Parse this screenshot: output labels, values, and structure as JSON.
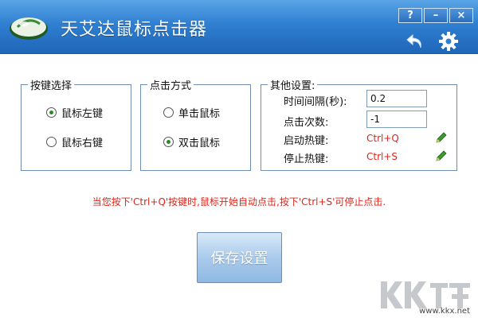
{
  "app": {
    "title": "天艾达鼠标点击器"
  },
  "window_buttons": {
    "help": "?",
    "minimize": "–",
    "close": "×"
  },
  "groups": {
    "key_select": {
      "legend": "按键选择",
      "options": [
        "鼠标左键",
        "鼠标右键"
      ],
      "selected_index": 0
    },
    "click_mode": {
      "legend": "点击方式",
      "options": [
        "单击鼠标",
        "双击鼠标"
      ],
      "selected_index": 1
    },
    "other": {
      "legend": "其他设置:",
      "interval_label": "时间间隔(秒):",
      "interval_value": "0.2",
      "count_label": "点击次数:",
      "count_value": "-1",
      "start_hotkey_label": "启动热键:",
      "start_hotkey": "Ctrl+Q",
      "stop_hotkey_label": "停止热键:",
      "stop_hotkey": "Ctrl+S"
    }
  },
  "hint": "当您按下'Ctrl+Q'按键时,鼠标开始自动点击,按下'Ctrl+S'可停止点击.",
  "save_button": "保存设置",
  "watermark": {
    "url": "www.kkx.net"
  },
  "colors": {
    "titlebar": "#2f7fd1",
    "hotkey": "#d9261c",
    "hint": "#e02418"
  }
}
